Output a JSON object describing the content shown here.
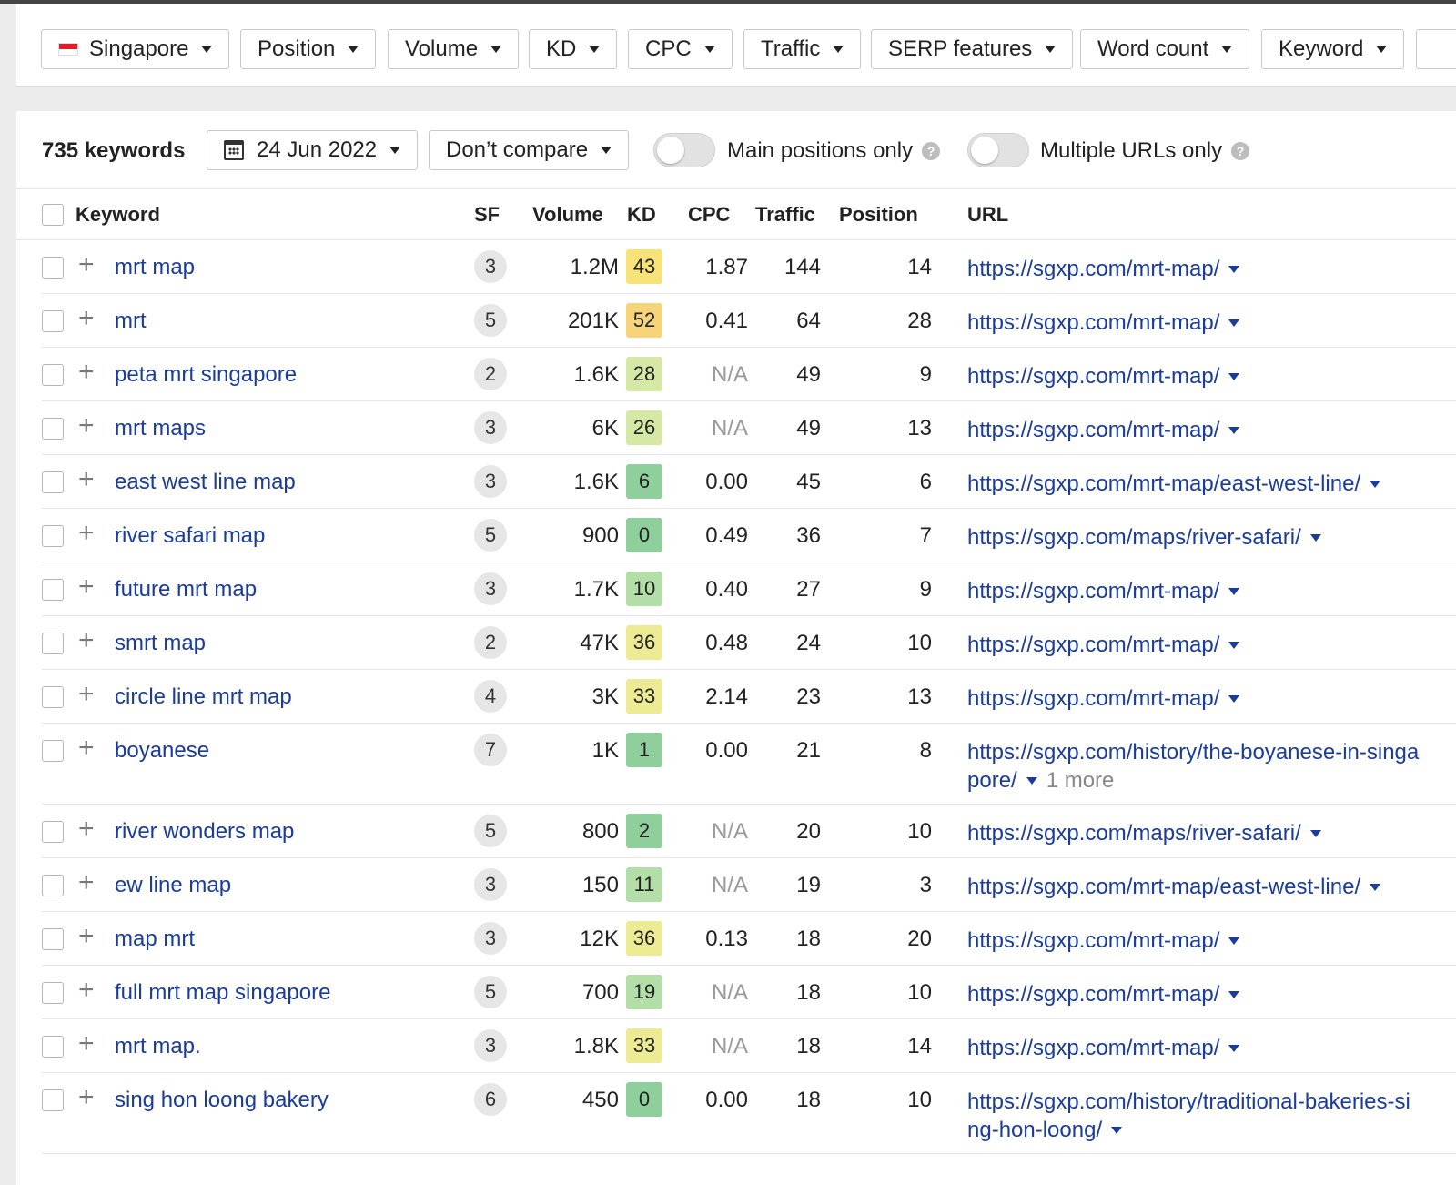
{
  "filters": [
    {
      "label": "Singapore",
      "flag": true
    },
    {
      "label": "Position"
    },
    {
      "label": "Volume"
    },
    {
      "label": "KD"
    },
    {
      "label": "CPC"
    },
    {
      "label": "Traffic"
    },
    {
      "label": "SERP features"
    },
    {
      "label": "Word count"
    },
    {
      "label": "Keyword"
    }
  ],
  "toolbar": {
    "keyword_count": "735 keywords",
    "date": "24 Jun 2022",
    "compare": "Don’t compare",
    "main_positions": "Main positions only",
    "multiple_urls": "Multiple URLs only",
    "help": "?"
  },
  "table": {
    "headers": {
      "keyword": "Keyword",
      "sf": "SF",
      "volume": "Volume",
      "kd": "KD",
      "cpc": "CPC",
      "traffic": "Traffic",
      "position": "Position",
      "url": "URL"
    },
    "rows": [
      {
        "keyword": "mrt map",
        "sf": "3",
        "volume": "1.2M",
        "kd": "43",
        "kd_color": "#f7e27a",
        "cpc": "1.87",
        "traffic": "144",
        "position": "14",
        "url": "https://sgxp.com/mrt-map/",
        "more": ""
      },
      {
        "keyword": "mrt",
        "sf": "5",
        "volume": "201K",
        "kd": "52",
        "kd_color": "#f7d47a",
        "cpc": "0.41",
        "traffic": "64",
        "position": "28",
        "url": "https://sgxp.com/mrt-map/",
        "more": ""
      },
      {
        "keyword": "peta mrt singapore",
        "sf": "2",
        "volume": "1.6K",
        "kd": "28",
        "kd_color": "#d6e8a5",
        "cpc": "N/A",
        "traffic": "49",
        "position": "9",
        "url": "https://sgxp.com/mrt-map/",
        "more": ""
      },
      {
        "keyword": "mrt maps",
        "sf": "3",
        "volume": "6K",
        "kd": "26",
        "kd_color": "#d6e8a5",
        "cpc": "N/A",
        "traffic": "49",
        "position": "13",
        "url": "https://sgxp.com/mrt-map/",
        "more": ""
      },
      {
        "keyword": "east west line map",
        "sf": "3",
        "volume": "1.6K",
        "kd": "6",
        "kd_color": "#8fcf9c",
        "cpc": "0.00",
        "traffic": "45",
        "position": "6",
        "url": "https://sgxp.com/mrt-map/east-west-line/",
        "more": ""
      },
      {
        "keyword": "river safari map",
        "sf": "5",
        "volume": "900",
        "kd": "0",
        "kd_color": "#8fcf9c",
        "cpc": "0.49",
        "traffic": "36",
        "position": "7",
        "url": "https://sgxp.com/maps/river-safari/",
        "more": ""
      },
      {
        "keyword": "future mrt map",
        "sf": "3",
        "volume": "1.7K",
        "kd": "10",
        "kd_color": "#b4dea8",
        "cpc": "0.40",
        "traffic": "27",
        "position": "9",
        "url": "https://sgxp.com/mrt-map/",
        "more": ""
      },
      {
        "keyword": "smrt map",
        "sf": "2",
        "volume": "47K",
        "kd": "36",
        "kd_color": "#ecea92",
        "cpc": "0.48",
        "traffic": "24",
        "position": "10",
        "url": "https://sgxp.com/mrt-map/",
        "more": ""
      },
      {
        "keyword": "circle line mrt map",
        "sf": "4",
        "volume": "3K",
        "kd": "33",
        "kd_color": "#ecea92",
        "cpc": "2.14",
        "traffic": "23",
        "position": "13",
        "url": "https://sgxp.com/mrt-map/",
        "more": ""
      },
      {
        "keyword": "boyanese",
        "sf": "7",
        "volume": "1K",
        "kd": "1",
        "kd_color": "#8fcf9c",
        "cpc": "0.00",
        "traffic": "21",
        "position": "8",
        "url": "https://sgxp.com/history/the-boyanese-in-singapore/",
        "more": "1 more"
      },
      {
        "keyword": "river wonders map",
        "sf": "5",
        "volume": "800",
        "kd": "2",
        "kd_color": "#8fcf9c",
        "cpc": "N/A",
        "traffic": "20",
        "position": "10",
        "url": "https://sgxp.com/maps/river-safari/",
        "more": ""
      },
      {
        "keyword": "ew line map",
        "sf": "3",
        "volume": "150",
        "kd": "11",
        "kd_color": "#b4dea8",
        "cpc": "N/A",
        "traffic": "19",
        "position": "3",
        "url": "https://sgxp.com/mrt-map/east-west-line/",
        "more": ""
      },
      {
        "keyword": "map mrt",
        "sf": "3",
        "volume": "12K",
        "kd": "36",
        "kd_color": "#ecea92",
        "cpc": "0.13",
        "traffic": "18",
        "position": "20",
        "url": "https://sgxp.com/mrt-map/",
        "more": ""
      },
      {
        "keyword": "full mrt map singapore",
        "sf": "5",
        "volume": "700",
        "kd": "19",
        "kd_color": "#b4dea8",
        "cpc": "N/A",
        "traffic": "18",
        "position": "10",
        "url": "https://sgxp.com/mrt-map/",
        "more": ""
      },
      {
        "keyword": "mrt map.",
        "sf": "3",
        "volume": "1.8K",
        "kd": "33",
        "kd_color": "#ecea92",
        "cpc": "N/A",
        "traffic": "18",
        "position": "14",
        "url": "https://sgxp.com/mrt-map/",
        "more": ""
      },
      {
        "keyword": "sing hon loong bakery",
        "sf": "6",
        "volume": "450",
        "kd": "0",
        "kd_color": "#8fcf9c",
        "cpc": "0.00",
        "traffic": "18",
        "position": "10",
        "url": "https://sgxp.com/history/traditional-bakeries-sing-hon-loong/",
        "more": ""
      }
    ]
  }
}
